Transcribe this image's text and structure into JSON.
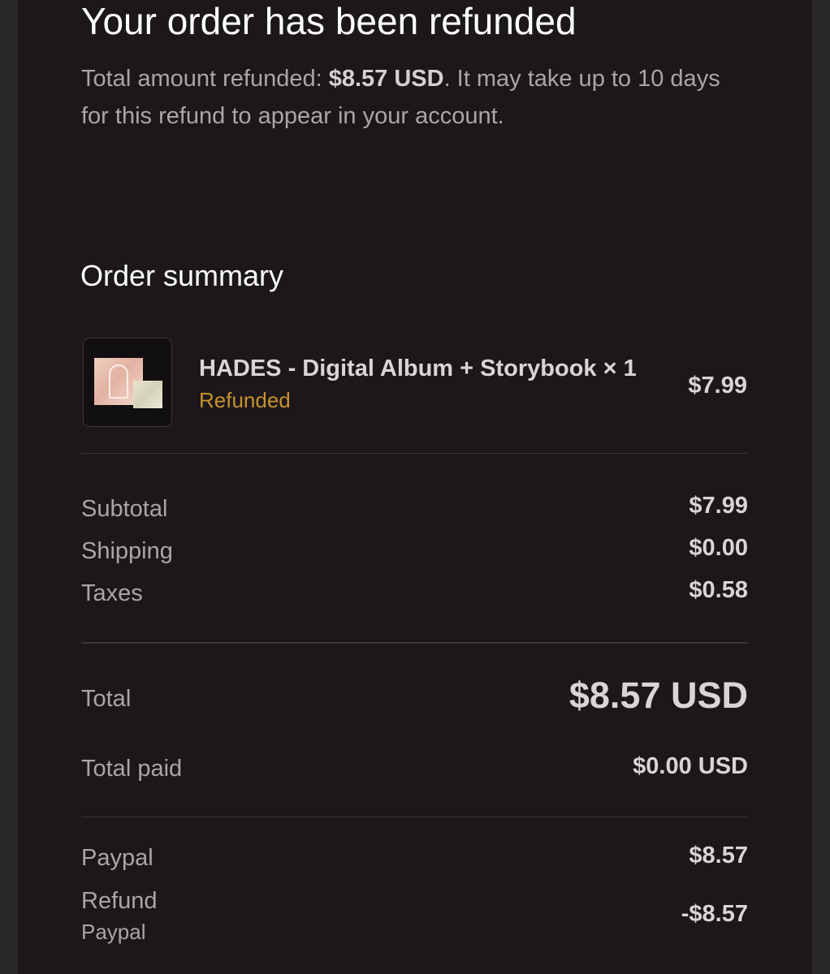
{
  "header": {
    "title": "Your order has been refunded",
    "refund_prefix": "Total amount refunded: ",
    "refund_amount": "$8.57 USD",
    "refund_suffix": ". It may take up to 10 days for this refund to appear in your account."
  },
  "summary": {
    "heading": "Order summary",
    "item": {
      "name": "HADES - Digital Album + Storybook × 1",
      "status": "Refunded",
      "price": "$7.99",
      "image_icon": "album-cover-image"
    },
    "lines": {
      "subtotal_label": "Subtotal",
      "subtotal_value": "$7.99",
      "shipping_label": "Shipping",
      "shipping_value": "$0.00",
      "taxes_label": "Taxes",
      "taxes_value": "$0.58"
    },
    "total": {
      "label": "Total",
      "value": "$8.57 USD"
    },
    "total_paid": {
      "label": "Total paid",
      "value": "$0.00 USD"
    },
    "payments": {
      "paypal_label": "Paypal",
      "paypal_value": "$8.57",
      "refund_label": "Refund",
      "refund_method": "Paypal",
      "refund_value": "-$8.57"
    }
  },
  "colors": {
    "background": "#1b171a",
    "outer_background": "#2a2729",
    "refunded_status": "#c7922c",
    "primary_text": "#ffffff",
    "muted_text": "#a9a5a8"
  }
}
